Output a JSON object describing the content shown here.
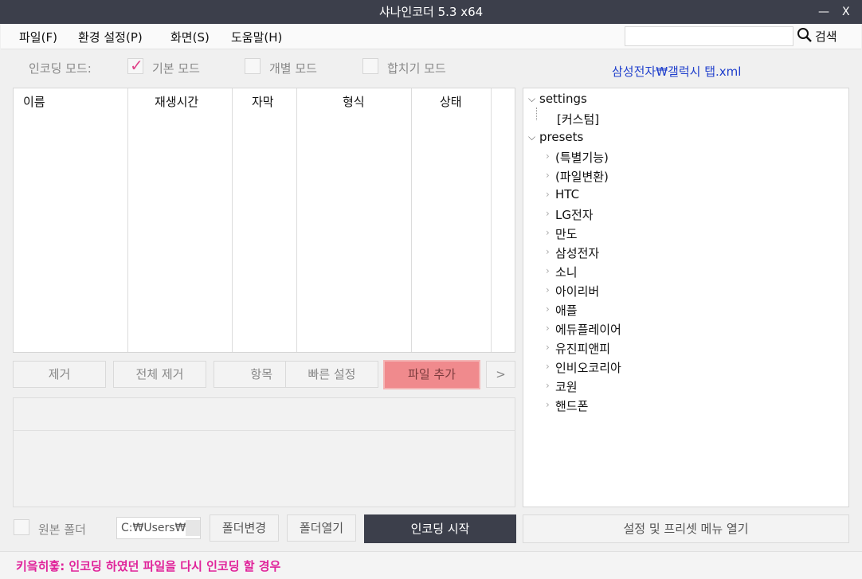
{
  "window": {
    "title": "샤나인코더  5.3  x64",
    "minimize": "—",
    "close": "X"
  },
  "menu": {
    "file": "파일(F)",
    "settings": "환경 설정(P)",
    "view": "화면(S)",
    "help": "도움말(H)",
    "search_label": "검색",
    "search_value": ""
  },
  "mode": {
    "label": "인코딩 모드:",
    "basic": "기본 모드",
    "individual": "개별 모드",
    "merge": "합치기 모드",
    "basic_checked": true
  },
  "preset_path": "삼성전자₩갤럭시 탭.xml",
  "file_list": {
    "columns": [
      "이름",
      "재생시간",
      "자막",
      "형식",
      "상태"
    ]
  },
  "buttons": {
    "remove": "제거",
    "remove_all": "전체 제거",
    "item": "항목",
    "quick_settings": "빠른 설정",
    "add_file": "파일 추가",
    "more": ">",
    "change_folder": "폴더변경",
    "open_folder": "폴더열기",
    "start_encoding": "인코딩 시작",
    "open_preset_menu": "설정 및 프리셋 메뉴 열기"
  },
  "output": {
    "source_folder_label": "원본 폴더",
    "path": "C:₩Users₩"
  },
  "tree": {
    "settings": {
      "label": "settings",
      "children": [
        "[커스텀]"
      ]
    },
    "presets": {
      "label": "presets",
      "children": [
        "(특별기능)",
        "(파일변환)",
        "HTC",
        "LG전자",
        "만도",
        "삼성전자",
        "소니",
        "아이리버",
        "애플",
        "에듀플레이어",
        "유진피앤피",
        "인비오코리아",
        "코원",
        "핸드폰"
      ]
    }
  },
  "status": {
    "message": "키읔히훟: 인코딩 하였던 파일을 다시 인코딩 할 경우"
  },
  "colors": {
    "titlebar": "#3c3f4b",
    "accent_button": "#f08a8d",
    "preset_path": "#1f3fcc",
    "status_text": "#e0239a",
    "check": "#e0458a"
  }
}
